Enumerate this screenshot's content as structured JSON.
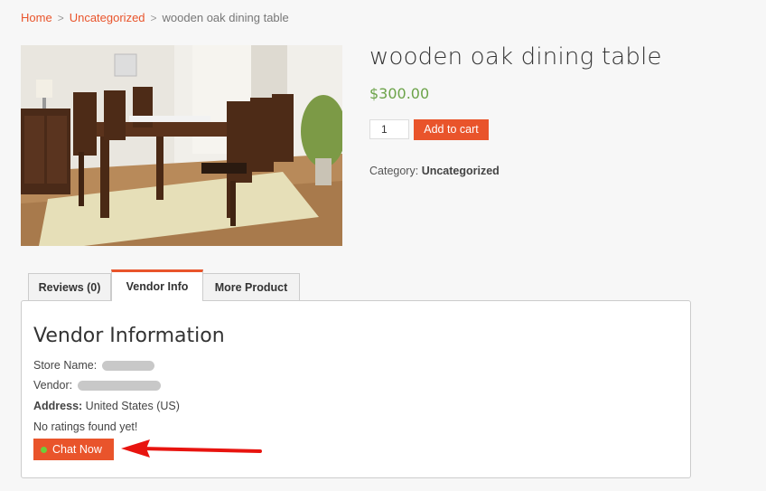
{
  "breadcrumb": {
    "home": "Home",
    "separator": ">",
    "category": "Uncategorized",
    "current": "wooden oak dining table"
  },
  "product": {
    "title": "wooden oak dining table",
    "price": "$300.00",
    "quantity": "1",
    "add_to_cart": "Add to cart",
    "category_label": "Category:",
    "category_value": "Uncategorized"
  },
  "tabs": [
    {
      "label": "Reviews (0)"
    },
    {
      "label": "Vendor Info"
    },
    {
      "label": "More Product"
    }
  ],
  "vendor": {
    "heading": "Vendor Information",
    "store_name_label": "Store Name:",
    "vendor_label": "Vendor:",
    "address_label": "Address:",
    "address_value": "United States (US)",
    "ratings": "No ratings found yet!",
    "chat_button": "Chat Now"
  },
  "colors": {
    "accent": "#e9542b",
    "price": "#6ca349",
    "online_dot": "#6ccf3a",
    "annotation_arrow": "#e8140f"
  }
}
